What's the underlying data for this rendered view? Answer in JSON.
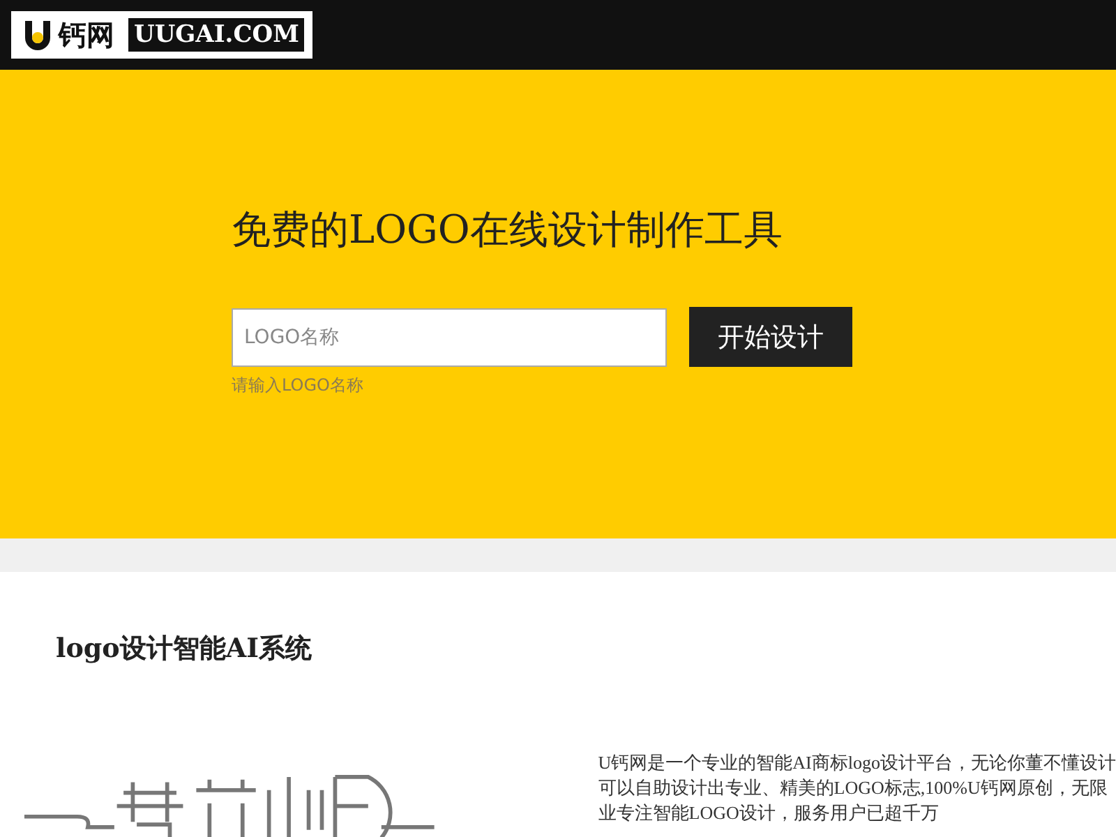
{
  "header": {
    "logo": {
      "brand_cn": "钙网",
      "domain": "UUGAI.COM"
    }
  },
  "hero": {
    "title": "免费的LOGO在线设计制作工具",
    "input": {
      "placeholder": "LOGO名称"
    },
    "hint": "请输入LOGO名称",
    "button": "开始设计"
  },
  "section": {
    "heading": "logo设计智能AI系统",
    "description_lines": [
      "U钙网是一个专业的智能AI商标logo设计平台，无论你董不懂设计",
      "可以自助设计出专业、精美的LOGO标志,100%U钙网原创，无限",
      "业专注智能LOGO设计，服务用户已超千万"
    ]
  }
}
